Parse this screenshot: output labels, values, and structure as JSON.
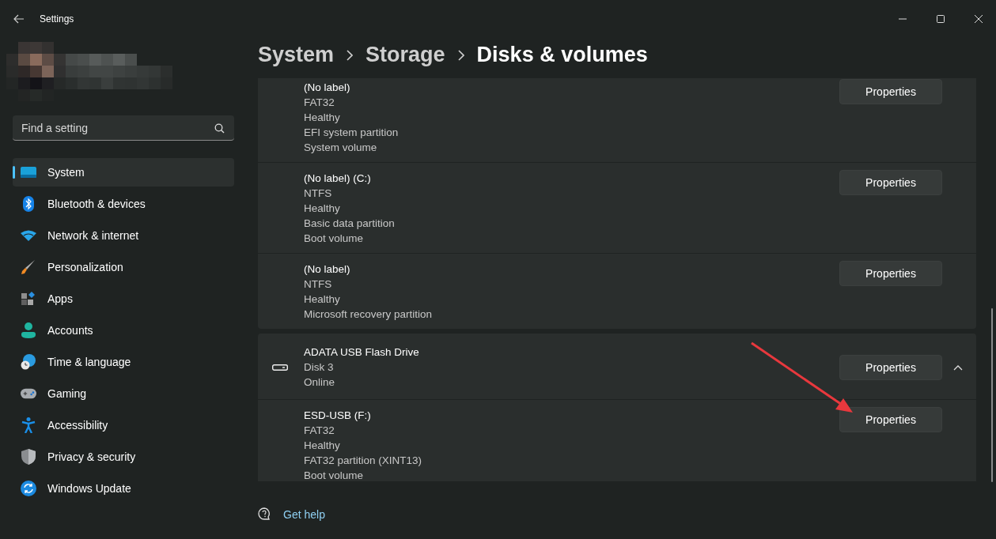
{
  "window": {
    "title": "Settings"
  },
  "search": {
    "placeholder": "Find a setting"
  },
  "nav": [
    {
      "label": "System",
      "selected": true
    },
    {
      "label": "Bluetooth & devices",
      "selected": false
    },
    {
      "label": "Network & internet",
      "selected": false
    },
    {
      "label": "Personalization",
      "selected": false
    },
    {
      "label": "Apps",
      "selected": false
    },
    {
      "label": "Accounts",
      "selected": false
    },
    {
      "label": "Time & language",
      "selected": false
    },
    {
      "label": "Gaming",
      "selected": false
    },
    {
      "label": "Accessibility",
      "selected": false
    },
    {
      "label": "Privacy & security",
      "selected": false
    },
    {
      "label": "Windows Update",
      "selected": false
    }
  ],
  "breadcrumb": [
    "System",
    "Storage",
    "Disks & volumes"
  ],
  "disks": [
    {
      "volumes": [
        {
          "title": "(No label)",
          "details": [
            "FAT32",
            "Healthy",
            "EFI system partition",
            "System volume"
          ],
          "button": "Properties"
        },
        {
          "title": "(No label) (C:)",
          "details": [
            "NTFS",
            "Healthy",
            "Basic data partition",
            "Boot volume"
          ],
          "button": "Properties"
        },
        {
          "title": "(No label)",
          "details": [
            "NTFS",
            "Healthy",
            "Microsoft recovery partition"
          ],
          "button": "Properties"
        }
      ]
    },
    {
      "name": "ADATA USB Flash Drive",
      "details": [
        "Disk 3",
        "Online"
      ],
      "button": "Properties",
      "expanded": true,
      "volumes": [
        {
          "title": "ESD-USB (F:)",
          "details": [
            "FAT32",
            "Healthy",
            "FAT32 partition (XINT13)",
            "Boot volume"
          ],
          "button": "Properties"
        }
      ]
    }
  ],
  "help_link": "Get help"
}
